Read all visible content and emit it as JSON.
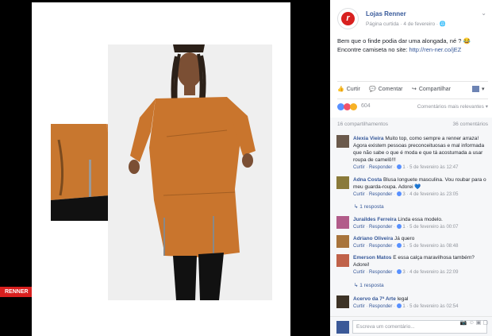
{
  "post": {
    "page_name": "Lojas Renner",
    "meta": "Página curtida · 4 de fevereiro ·",
    "text_line1": "Bem que o finde podia dar uma alongada, né ? 😂",
    "text_line2_prefix": "Encontre camiseta no site: ",
    "link": "http://ren-ner.co/jEZ",
    "logo_letter": "r",
    "brand_tag": "RENNER"
  },
  "actions": {
    "like": "Curtir",
    "comment": "Comentar",
    "share": "Compartilhar"
  },
  "reactions": {
    "count": "604",
    "sort": "Comentários mais relevantes",
    "colors": {
      "like": "#5890ff",
      "love": "#f25268",
      "haha": "#f7b125"
    }
  },
  "counts": {
    "shares": "16 compartilhamentos",
    "comments": "36 comentários"
  },
  "comments": [
    {
      "name": "Alexia Vieira",
      "text": "Muito top, como sempre a renner arraza! Agora existem pessoas preconceituosas e mal informada que não sabe o que é moda e que tá acostumada a usar roupa de camelô!!!",
      "like": "Curtir",
      "reply": "Responder",
      "likes": "1",
      "time": "5 de fevereiro às 12:47"
    },
    {
      "name": "Adna Costa",
      "text": "Blusa longuete masculina. Vou roubar para o meu guarda-roupa. Adorei 💙",
      "like": "Curtir",
      "reply": "Responder",
      "likes": "3",
      "time": "4 de fevereiro às 23:05",
      "replies": "1 resposta"
    },
    {
      "name": "Juraildes Ferreira",
      "text": "Linda essa modelo.",
      "like": "Curtir",
      "reply": "Responder",
      "likes": "1",
      "time": "5 de fevereiro às 00:07"
    },
    {
      "name": "Adriano Oliveira",
      "text": "Já quero",
      "like": "Curtir",
      "reply": "Responder",
      "likes": "1",
      "time": "5 de fevereiro às 08:48"
    },
    {
      "name": "Emerson Matos",
      "text": "E essa calça maravilhosa também? Adorei!",
      "like": "Curtir",
      "reply": "Responder",
      "likes": "3",
      "time": "4 de fevereiro às 22:09",
      "replies": "1 resposta"
    },
    {
      "name": "Acervo da 7ª Arte",
      "text": "legal",
      "like": "Curtir",
      "reply": "Responder",
      "likes": "1",
      "time": "5 de fevereiro às 02:54"
    }
  ],
  "composer": {
    "placeholder": "Escreva um comentário..."
  },
  "icons": [
    "globe-icon",
    "like-icon",
    "comment-icon",
    "share-icon",
    "chevron-down-icon",
    "camera-icon",
    "emoji-icon",
    "gif-icon",
    "sticker-icon"
  ]
}
